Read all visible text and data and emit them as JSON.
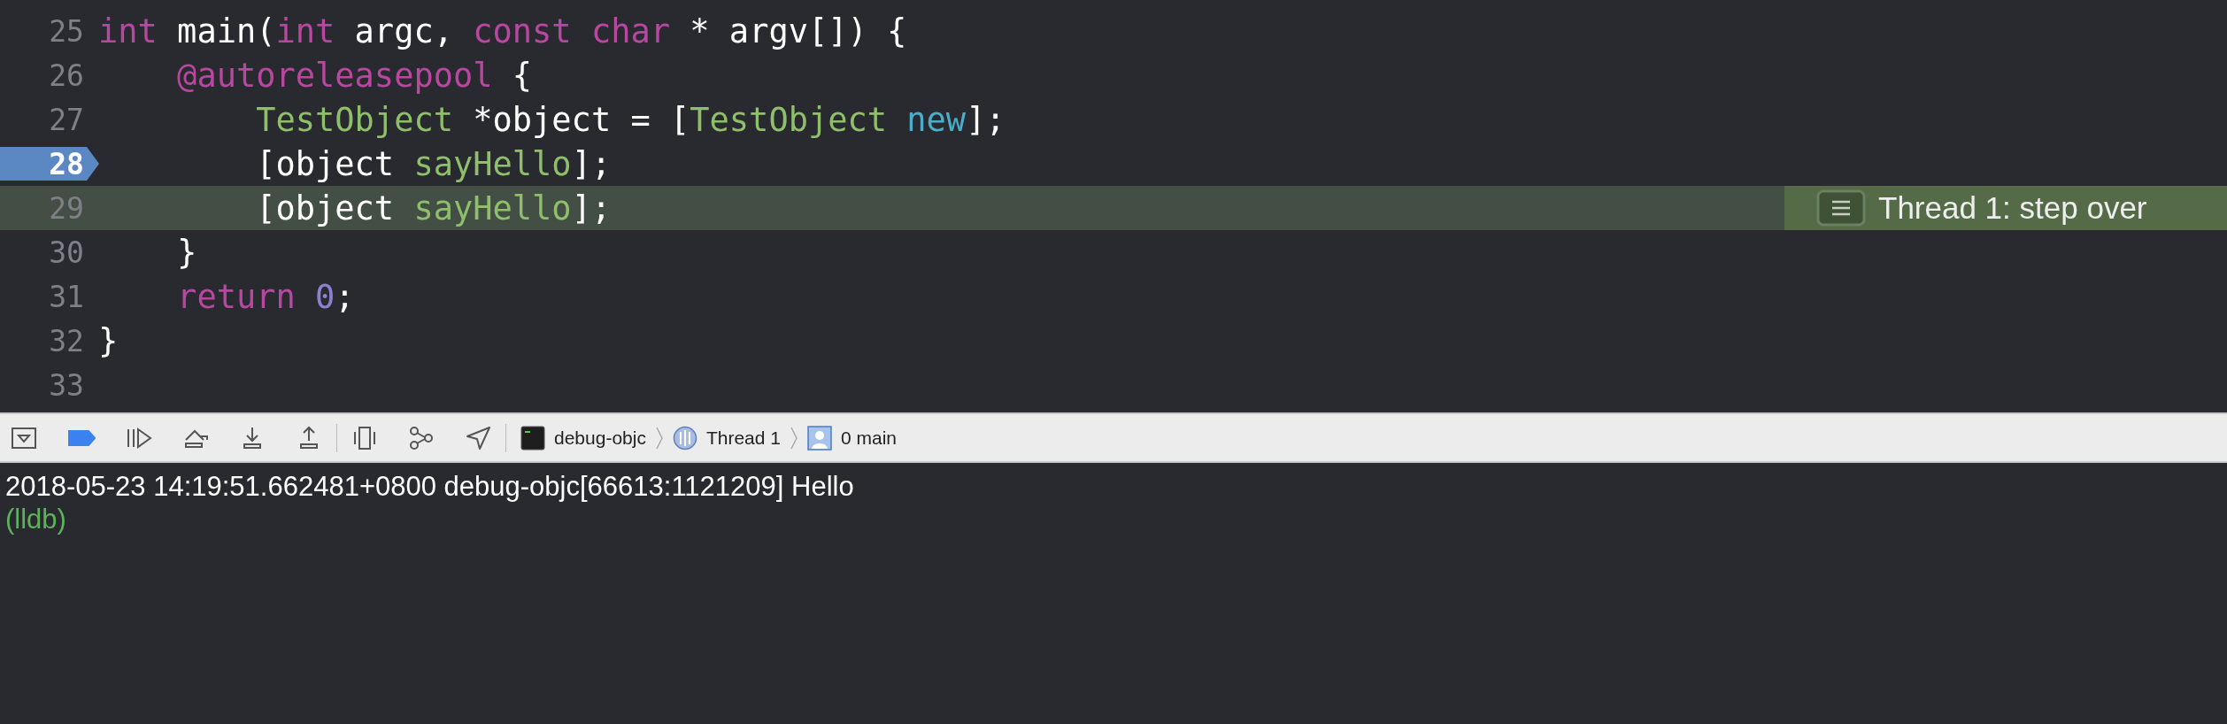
{
  "editor": {
    "lines": [
      {
        "number": "25",
        "breakpoint": false,
        "current": false,
        "tokens": [
          {
            "text": "int",
            "kind": "keyword"
          },
          {
            "text": " main(",
            "kind": "plain"
          },
          {
            "text": "int",
            "kind": "keyword"
          },
          {
            "text": " argc, ",
            "kind": "plain"
          },
          {
            "text": "const",
            "kind": "keyword"
          },
          {
            "text": " char",
            "kind": "keyword"
          },
          {
            "text": " * argv[]) {",
            "kind": "plain"
          }
        ]
      },
      {
        "number": "26",
        "breakpoint": false,
        "current": false,
        "tokens": [
          {
            "text": "    @autoreleasepool",
            "kind": "keyword"
          },
          {
            "text": " {",
            "kind": "plain"
          }
        ]
      },
      {
        "number": "27",
        "breakpoint": false,
        "current": false,
        "tokens": [
          {
            "text": "        TestObject",
            "kind": "type"
          },
          {
            "text": " *object = [",
            "kind": "plain"
          },
          {
            "text": "TestObject",
            "kind": "type"
          },
          {
            "text": " new",
            "kind": "builtin"
          },
          {
            "text": "];",
            "kind": "plain"
          }
        ]
      },
      {
        "number": "28",
        "breakpoint": true,
        "current": false,
        "tokens": [
          {
            "text": "        [object ",
            "kind": "plain"
          },
          {
            "text": "sayHello",
            "kind": "method"
          },
          {
            "text": "];",
            "kind": "plain"
          }
        ]
      },
      {
        "number": "29",
        "breakpoint": false,
        "current": true,
        "annotation": "Thread 1: step over",
        "tokens": [
          {
            "text": "        [object ",
            "kind": "plain"
          },
          {
            "text": "sayHello",
            "kind": "method"
          },
          {
            "text": "];",
            "kind": "plain"
          }
        ]
      },
      {
        "number": "30",
        "breakpoint": false,
        "current": false,
        "tokens": [
          {
            "text": "    }",
            "kind": "plain"
          }
        ]
      },
      {
        "number": "31",
        "breakpoint": false,
        "current": false,
        "tokens": [
          {
            "text": "    return",
            "kind": "keyword"
          },
          {
            "text": " 0",
            "kind": "number"
          },
          {
            "text": ";",
            "kind": "plain"
          }
        ]
      },
      {
        "number": "32",
        "breakpoint": false,
        "current": false,
        "tokens": [
          {
            "text": "}",
            "kind": "plain"
          }
        ]
      },
      {
        "number": "33",
        "breakpoint": false,
        "current": false
      }
    ]
  },
  "debug_bar": {
    "breakpoints_active": true,
    "breadcrumbs": [
      {
        "label": "debug-objc",
        "kind": "process"
      },
      {
        "label": "Thread 1",
        "kind": "thread"
      },
      {
        "label": "0 main",
        "kind": "frame"
      }
    ]
  },
  "console": {
    "lines": [
      {
        "text": "2018-05-23 14:19:51.662481+0800 debug-objc[66613:1121209] Hello",
        "kind": "output"
      },
      {
        "text": "(lldb)",
        "kind": "prompt"
      }
    ]
  }
}
